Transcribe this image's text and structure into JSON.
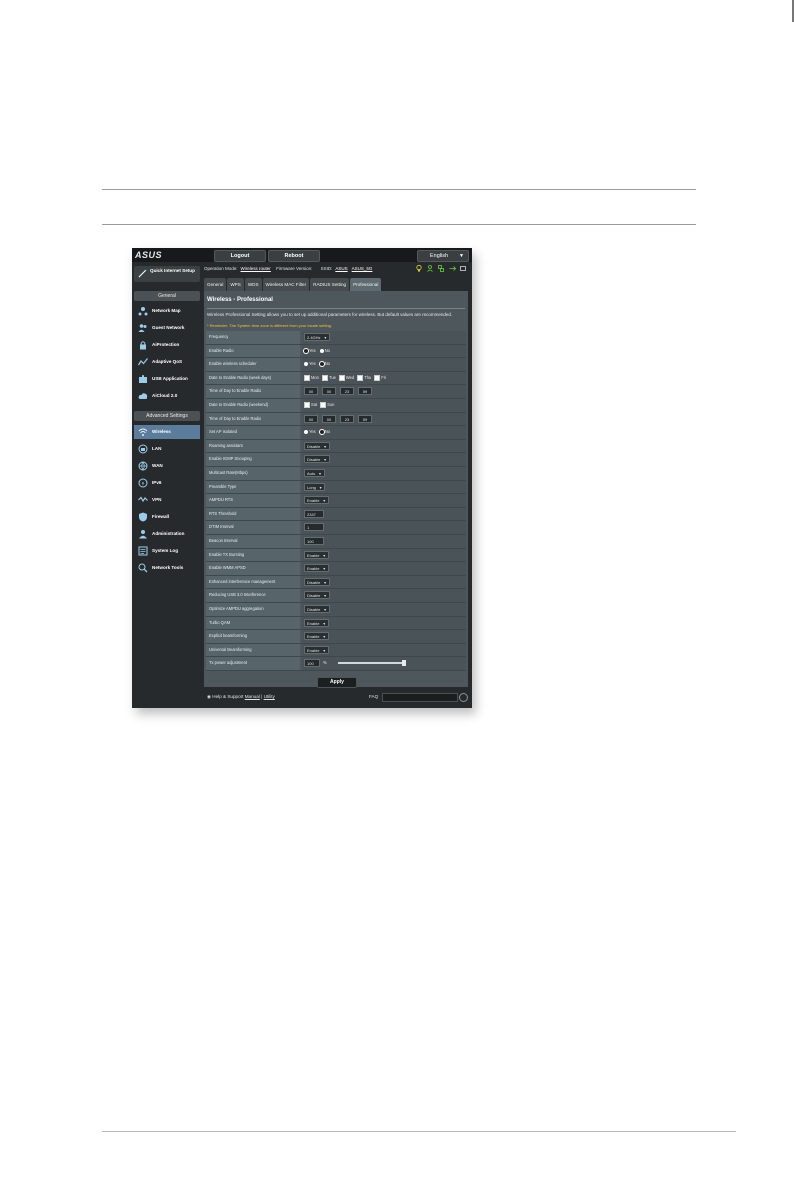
{
  "topbar": {
    "logo": "ASUS",
    "logout_label": "Logout",
    "reboot_label": "Reboot",
    "language": "English"
  },
  "operation_bar": {
    "mode_label": "Operation Mode:",
    "mode_value": "Wireless router",
    "firmware_label": "Firmware Version:",
    "firmware_value": "",
    "ssid_label": "SSID:",
    "ssid_1": "ASUS",
    "ssid_2": "ASUS_5G"
  },
  "tabs": [
    "General",
    "WPS",
    "WDS",
    "Wireless MAC Filter",
    "RADIUS Setting",
    "Professional"
  ],
  "active_tab": "Professional",
  "sidebar": {
    "quick_setup": "Quick Internet Setup",
    "general_header": "General",
    "general_items": [
      "Network Map",
      "Guest Network",
      "AiProtection",
      "Adaptive QoS",
      "USB Application",
      "AiCloud 2.0"
    ],
    "advanced_header": "Advanced Settings",
    "advanced_items": [
      "Wireless",
      "LAN",
      "WAN",
      "IPv6",
      "VPN",
      "Firewall",
      "Administration",
      "System Log",
      "Network Tools"
    ],
    "active_item": "Wireless"
  },
  "panel": {
    "title": "Wireless - Professional",
    "description": "Wireless Professional Setting allows you to set up additional parameters for wireless. But default values are recommended.",
    "warning": "* Reminder: The System time zone is different from your locale setting.",
    "apply_label": "Apply"
  },
  "settings": [
    {
      "label": "Frequency",
      "type": "select",
      "value": "2.4GHz"
    },
    {
      "label": "Enable Radio",
      "type": "radio",
      "options": [
        "Yes",
        "No"
      ],
      "selected": 0
    },
    {
      "label": "Enable wireless scheduler",
      "type": "radio",
      "options": [
        "Yes",
        "No"
      ],
      "selected": 1
    },
    {
      "label": "Date to Enable Radio (week days)",
      "type": "check",
      "options": [
        "Mon",
        "Tue",
        "Wed",
        "Thu",
        "Fri"
      ]
    },
    {
      "label": "Time of Day to Enable Radio",
      "type": "time",
      "values": [
        "00",
        "00",
        "23",
        "59"
      ]
    },
    {
      "label": "Date to Enable Radio (weekend)",
      "type": "check",
      "options": [
        "Sat",
        "Sun"
      ]
    },
    {
      "label": "Time of Day to Enable Radio",
      "type": "time",
      "values": [
        "00",
        "00",
        "23",
        "59"
      ]
    },
    {
      "label": "Set AP Isolated",
      "type": "radio",
      "options": [
        "Yes",
        "No"
      ],
      "selected": 1
    },
    {
      "label": "Roaming assistant",
      "type": "select",
      "value": "Disable"
    },
    {
      "label": "Enable IGMP Snooping",
      "type": "select",
      "value": "Disable"
    },
    {
      "label": "Multicast Rate(Mbps)",
      "type": "select",
      "value": "Auto"
    },
    {
      "label": "Preamble Type",
      "type": "select",
      "value": "Long"
    },
    {
      "label": "AMPDU RTS",
      "type": "select",
      "value": "Enable"
    },
    {
      "label": "RTS Threshold",
      "type": "input",
      "value": "2347"
    },
    {
      "label": "DTIM Interval",
      "type": "input",
      "value": "1"
    },
    {
      "label": "Beacon Interval",
      "type": "input",
      "value": "100"
    },
    {
      "label": "Enable TX Bursting",
      "type": "select",
      "value": "Enable"
    },
    {
      "label": "Enable WMM APSD",
      "type": "select",
      "value": "Enable"
    },
    {
      "label": "Enhanced interference management",
      "type": "select",
      "value": "Disable"
    },
    {
      "label": "Reducing USB 3.0 Interference",
      "type": "select",
      "value": "Disable"
    },
    {
      "label": "Optimize AMPDU aggregation",
      "type": "select",
      "value": "Disable"
    },
    {
      "label": "Turbo QAM",
      "type": "select",
      "value": "Enable"
    },
    {
      "label": "Explicit beamforming",
      "type": "select",
      "value": "Enable"
    },
    {
      "label": "Universal Beamforming",
      "type": "select",
      "value": "Enable"
    },
    {
      "label": "Tx power adjustment",
      "type": "slider",
      "value": "100",
      "unit": "%",
      "level": 1.0
    }
  ],
  "footer": {
    "help": "Help & Support",
    "manual": "Manual",
    "separator": "|",
    "utility": "Utility",
    "faq": "FAQ"
  },
  "colors": {
    "panel_bg": "#4e585c",
    "active_nav": "#5b7c9a",
    "warning": "#f0c040",
    "status_green": "#6ad13b",
    "status_yellow": "#e2d33a"
  }
}
